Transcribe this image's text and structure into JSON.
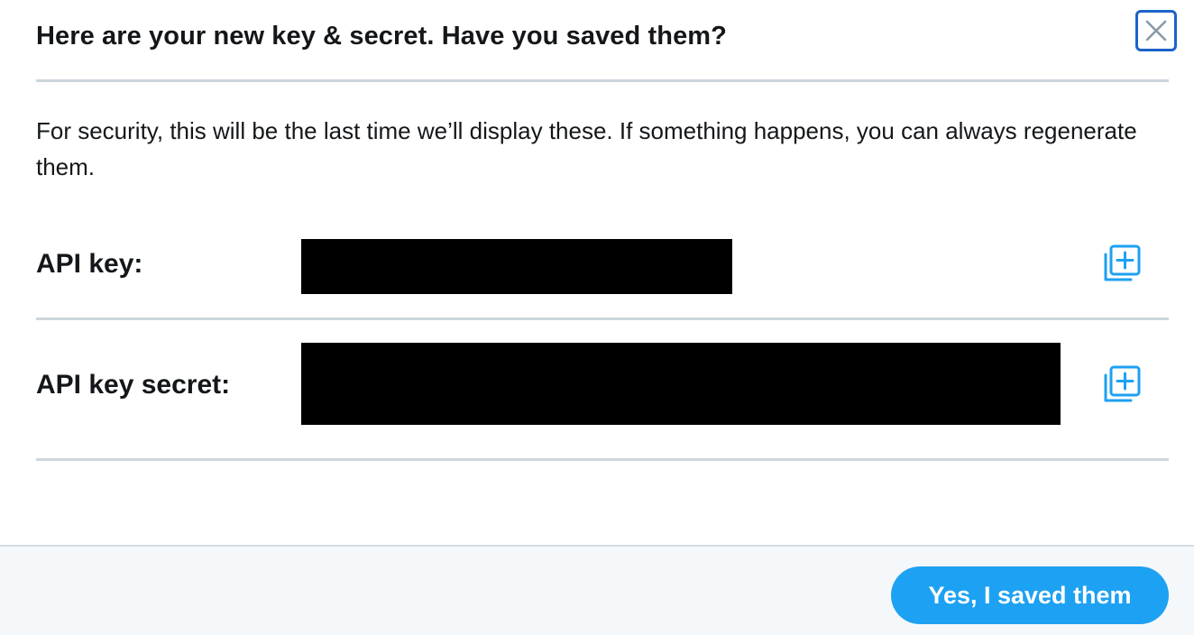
{
  "dialog": {
    "title": "Here are your new key & secret. Have you saved them?",
    "close_icon": "close-icon",
    "description": "For security, this will be the last time we’ll display these. If something happens, you can always regenerate them."
  },
  "fields": [
    {
      "label": "API key:",
      "value_redacted": true,
      "copy_icon": "copy-add-icon"
    },
    {
      "label": "API key secret:",
      "value_redacted": true,
      "copy_icon": "copy-add-icon"
    }
  ],
  "footer": {
    "confirm_label": "Yes, I saved them"
  },
  "colors": {
    "accent": "#1da1f2",
    "focus_ring": "#1b63c9",
    "divider": "#ccd6dd",
    "footer_bg": "#f5f8fa"
  }
}
